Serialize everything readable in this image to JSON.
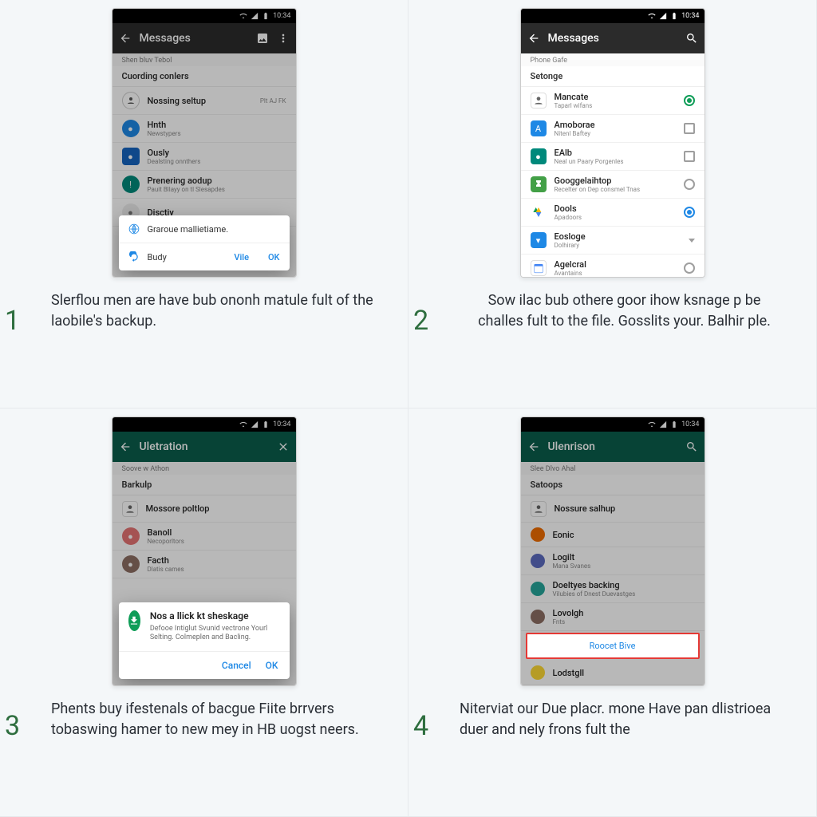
{
  "statusbar_time": "10:34",
  "step1": {
    "num": "1",
    "appbar_title": "Messages",
    "section_top": "Shen bluv  Tebol",
    "section_header": "Cuording conlers",
    "items": [
      {
        "title": "Nossing seltup",
        "subtitle": "",
        "trailing": "Plt  AJ FK"
      },
      {
        "title": "Hnth",
        "subtitle": "Newstypers"
      },
      {
        "title": "Ously",
        "subtitle": "Dealsting onnthers"
      },
      {
        "title": "Prenering aodup",
        "subtitle": "Pauit Bllayy on tl Slesapdes"
      },
      {
        "title": "Disctiy",
        "subtitle": ""
      }
    ],
    "dialog_line1": "Graroue mallietiame.",
    "dialog_line2": "Budy",
    "dialog_vile": "Vile",
    "dialog_ok": "OK",
    "caption": "Slerflou men are have bub ononh matule fult of the laobile's backup."
  },
  "step2": {
    "num": "2",
    "appbar_title": "Messages",
    "section_top": "Phone Gafe",
    "section_header": "Setonge",
    "items": [
      {
        "title": "Mancate",
        "subtitle": "Taparl wifans",
        "control": "radio-green-on"
      },
      {
        "title": "Amoborae",
        "subtitle": "Nitenl Baftey",
        "control": "checkbox"
      },
      {
        "title": "EAlb",
        "subtitle": "Neal un Paary Porgenles",
        "control": "checkbox"
      },
      {
        "title": "Googgelaihtop",
        "subtitle": "Recelter on Dep consmel Tnas",
        "control": "radio-off"
      },
      {
        "title": "Dools",
        "subtitle": "Apadoors",
        "control": "radio-blue-on"
      },
      {
        "title": "Eosloge",
        "subtitle": "Dolhirary",
        "control": "caret"
      },
      {
        "title": "Agelcral",
        "subtitle": "Avantains",
        "control": "radio-off"
      }
    ],
    "caption": "Sow ilac bub othere goor ihow ksnage p be challes fult to the file. Gosslits your. Balhir ple."
  },
  "step3": {
    "num": "3",
    "appbar_title": "Uletration",
    "section_top": "Soove w Athon",
    "section_header": "Barkulp",
    "items": [
      {
        "title": "Mossore poltlop",
        "subtitle": ""
      },
      {
        "title": "Banoll",
        "subtitle": "Necoporltors"
      },
      {
        "title": "Facth",
        "subtitle": "Dlatis cames"
      }
    ],
    "dialog_title": "Nos a llick kt sheskage",
    "dialog_body": "Defooe Intiglut Svunid vectrone Yourl Selting. Colmeplen and Bacling.",
    "dialog_cancel": "Cancel",
    "dialog_ok": "OK",
    "caption": "Phents buy ifestenals of bacgue Fiite brrvers tobaswing hamer to new mey in HB uogst neers."
  },
  "step4": {
    "num": "4",
    "appbar_title": "Ulenrison",
    "section_top": "Slee Dlvo Ahal",
    "section_header": "Satoops",
    "items": [
      {
        "title": "Nossure salhup",
        "subtitle": ""
      },
      {
        "title": "Eonic",
        "subtitle": ""
      },
      {
        "title": "Logilt",
        "subtitle": "Mana Svanes"
      },
      {
        "title": "Doeltyes backing",
        "subtitle": "Vilubies of Dnest Duevastges"
      },
      {
        "title": "Lovolgh",
        "subtitle": "Fnts"
      }
    ],
    "highlight": "Roocet Bive",
    "last_item": "Lodstgll",
    "caption": "Niterviat our Due placr. mone Have pan dlistrioea duer and nely frons fult the"
  }
}
